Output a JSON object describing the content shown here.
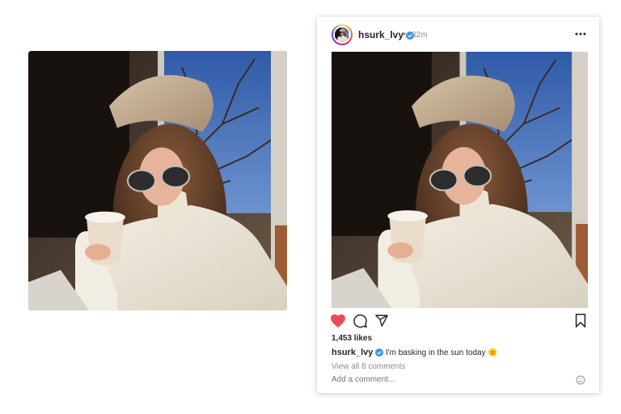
{
  "post": {
    "username": "hsurk_lvy",
    "verified": true,
    "separator": "•",
    "time_ago": "32m",
    "likes": "1,453 likes",
    "caption_text": "I'm basking in the sun today",
    "caption_emoji": "🌞",
    "view_comments": "View all 8 comments",
    "comment_placeholder": "Add a comment...",
    "liked": true
  },
  "icons": {
    "more": "more-horizontal-icon",
    "like": "heart-icon",
    "comment": "comment-bubble-icon",
    "share": "send-paper-plane-icon",
    "save": "bookmark-icon",
    "verified": "verified-badge-icon",
    "emoji": "smiley-face-icon"
  },
  "colors": {
    "like_red": "#ed4956",
    "verified_blue": "#3897f0",
    "text_dark": "#262626",
    "text_muted": "#8e8e8e"
  }
}
